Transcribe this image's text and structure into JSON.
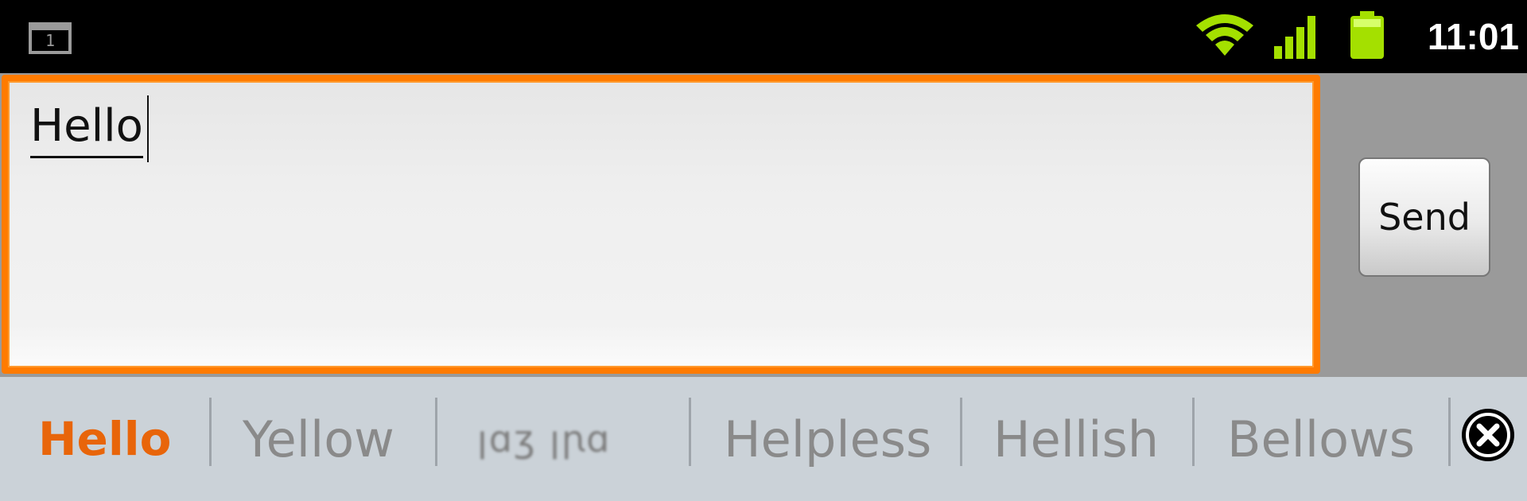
{
  "status_bar": {
    "notification_count": "1",
    "time": "11:01",
    "icons": [
      "notification-icon",
      "wifi-icon",
      "signal-icon",
      "battery-icon"
    ],
    "accent_color": "#a4e000"
  },
  "compose": {
    "message_text": "Hello",
    "send_label": "Send",
    "focus_color": "#ff7b00"
  },
  "suggestions": {
    "items": [
      "Hello",
      "Yellow",
      "ꞁɑʒ ꞁꞃɑ",
      "Helpless",
      "Hellish",
      "Bellows"
    ],
    "primary_color": "#e8650a",
    "close_icon": "close-icon"
  }
}
